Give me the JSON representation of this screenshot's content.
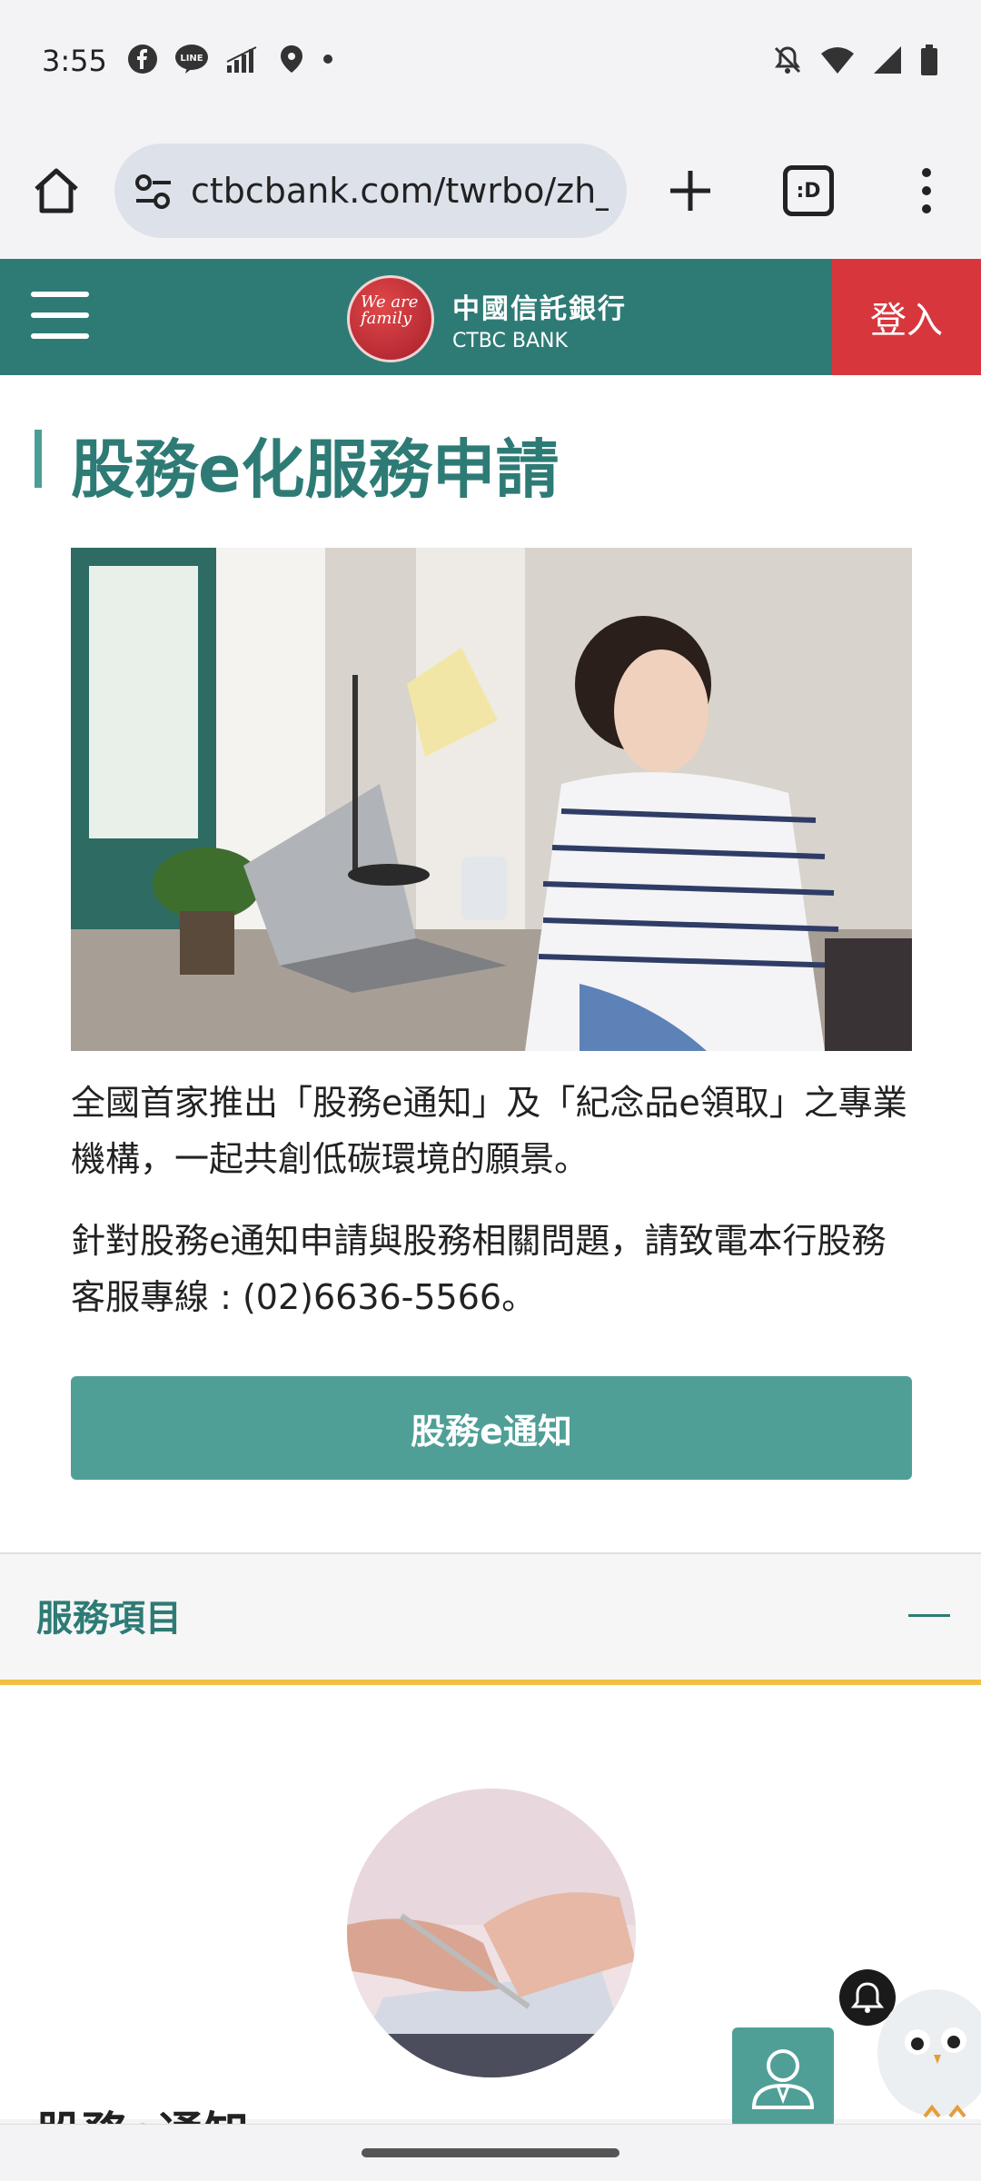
{
  "status": {
    "time": "3:55",
    "left_icons": [
      "facebook-icon",
      "line-icon",
      "signal-bars-icon",
      "location-icon",
      "dot-icon"
    ],
    "right_icons": [
      "mute-icon",
      "wifi-icon",
      "cell-icon",
      "battery-icon"
    ]
  },
  "browser": {
    "url": "ctbcbank.com/twrbo/zh_",
    "tab_count": ":D"
  },
  "header": {
    "logo_badge_text": "We are family",
    "logo_zh": "中國信託銀行",
    "logo_en": "CTBC BANK",
    "login": "登入"
  },
  "main": {
    "title": "股務e化服務申請",
    "desc1": "全國首家推出「股務e通知」及「紀念品e領取」之專業機構，一起共創低碳環境的願景。",
    "desc2": "針對股務e通知申請與股務相關問題，請致電本行股務客服專線 : (02)6636-5566。",
    "cta": "股務e通知"
  },
  "section": {
    "label": "服務項目",
    "sub_title": "股務e通知"
  },
  "colors": {
    "brand_teal": "#2e7b76",
    "button_teal": "#4f9f97",
    "login_red": "#d8363d",
    "accent_yellow": "#f1c042"
  }
}
